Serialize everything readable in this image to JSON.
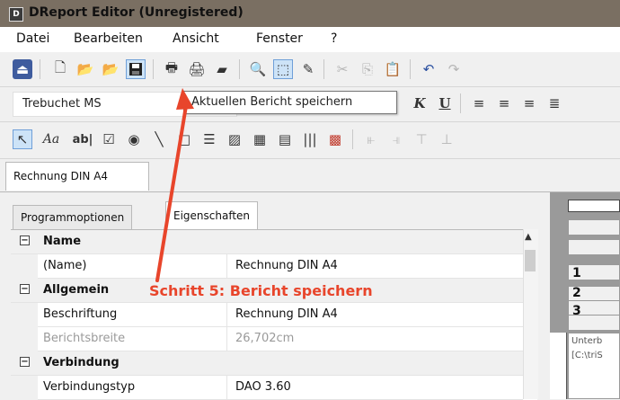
{
  "window": {
    "app_icon_letter": "D",
    "title": "DReport Editor (Unregistered)"
  },
  "menu": [
    "Datei",
    "Bearbeiten",
    "Ansicht",
    "Fenster",
    "?"
  ],
  "toolbar1": {
    "icons": [
      "app-menu-icon",
      "new-document-icon",
      "open-folder-icon",
      "open-file-icon",
      "save-icon",
      "print-icon",
      "print-preview-icon",
      "page-setup-icon",
      "zoom-icon",
      "select-report-icon",
      "edit-report-icon",
      "cut-icon",
      "copy-icon",
      "paste-icon",
      "undo-icon",
      "redo-icon"
    ]
  },
  "tooltip": {
    "text": "Aktuellen Bericht speichern"
  },
  "toolbar2": {
    "font_name": "Trebuchet MS",
    "italic_label": "K",
    "underline_label": "U"
  },
  "toolbar3": {
    "label_tool": "Aa",
    "textbox_tool": "ab|"
  },
  "doc_tab": {
    "label": "Rechnung DIN A4"
  },
  "panel": {
    "tabs": [
      "Programmoptionen",
      "Eigenschaften"
    ],
    "active_tab": "Eigenschaften",
    "rows": [
      {
        "type": "category",
        "toggle": "⊟",
        "label": "Name"
      },
      {
        "type": "property",
        "name": "(Name)",
        "value": "Rechnung DIN A4"
      },
      {
        "type": "category",
        "toggle": "⊟",
        "label": "Allgemein"
      },
      {
        "type": "property",
        "name": "Beschriftung",
        "value": "Rechnung DIN A4"
      },
      {
        "type": "property",
        "name": "Berichtsbreite",
        "value": "26,702cm",
        "disabled": true
      },
      {
        "type": "category",
        "toggle": "⊟",
        "label": "Verbindung"
      },
      {
        "type": "property",
        "name": "Verbindungstyp",
        "value": "DAO 3.60"
      }
    ]
  },
  "designer": {
    "band_numbers": [
      "1",
      "2",
      "3"
    ],
    "band_text": [
      "Unterb",
      "[C:\\triS"
    ]
  },
  "annotation": {
    "text": "Schritt 5: Bericht speichern",
    "color": "#e8452b"
  },
  "colors": {
    "title_bar": "#7a6f62",
    "accent": "#e8452b"
  }
}
